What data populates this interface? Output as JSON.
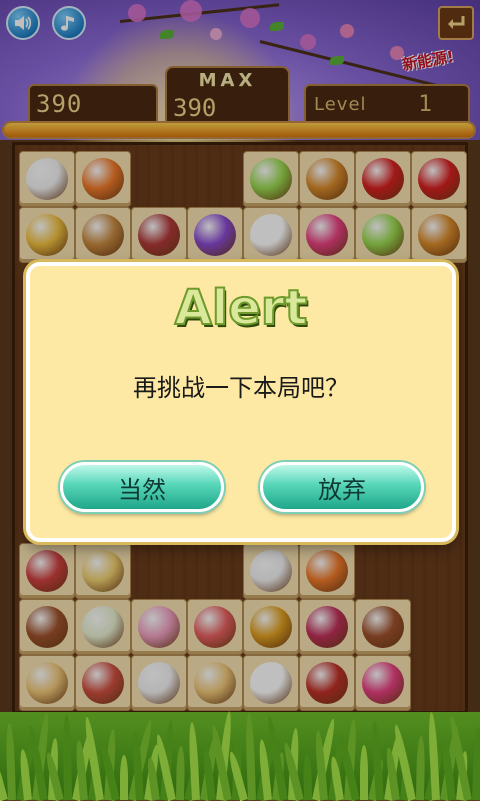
{
  "header": {
    "sound_icon": "speaker-icon",
    "music_icon": "music-note-icon",
    "back_icon": "return-arrow-icon",
    "logo_text": "新能源!"
  },
  "scoreboard": {
    "current_score": "390",
    "max_label": "MAX",
    "max_score": "390",
    "level_label": "Level",
    "level_value": "1",
    "time_progress": 1.0
  },
  "board": {
    "tile_icons": [
      "rice-cake",
      "fruit-bowl",
      "cake-slice",
      "hamburger",
      "soda-cup",
      "soda-cup",
      "honey-toast",
      "cupcake",
      "layer-cake",
      "star-cookies",
      "coffee-cup",
      "candy",
      "cake-slice",
      "hamburger",
      "tart",
      "donut",
      "rice-cake",
      "fruit-bowl",
      "strawberry-cake",
      "dumplings",
      "ice-cream",
      "swiss-roll",
      "pudding",
      "heart-cookie",
      "strawberry-cake",
      "sandwich",
      "ham",
      "rice-cake",
      "sandwich",
      "coffee-cup",
      "sausages",
      "candy"
    ]
  },
  "dialog": {
    "title": "Alert",
    "message": "再挑战一下本局吧？",
    "confirm_label": "当然",
    "cancel_label": "放弃"
  },
  "colors": {
    "dialog_bg": "#fde9a3",
    "button_teal": "#57d6b8",
    "title_green": "#d9e89a",
    "board_wood": "#6a3d1c"
  }
}
